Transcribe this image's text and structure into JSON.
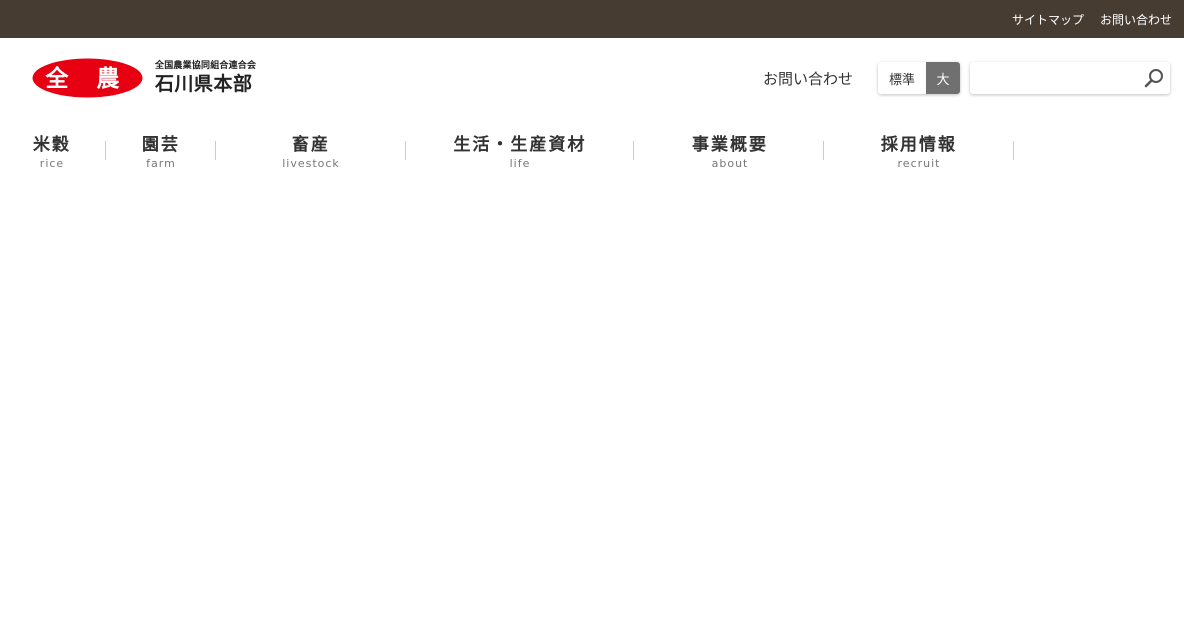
{
  "topbar": {
    "links": [
      "サイトマップ",
      "お問い合わせ"
    ]
  },
  "logo": {
    "mark_text": "全 農",
    "org_name": "全国農業協同組合連合会",
    "branch_name": "石川県本部",
    "mark_color": "#e60012"
  },
  "header": {
    "contact_label": "お問い合わせ",
    "font_size": {
      "standard_label": "標準",
      "large_label": "大"
    },
    "search": {
      "placeholder": "",
      "value": ""
    }
  },
  "gnav": {
    "items": [
      {
        "jp": "米穀",
        "en": "rice"
      },
      {
        "jp": "園芸",
        "en": "farm"
      },
      {
        "jp": "畜産",
        "en": "livestock"
      },
      {
        "jp": "生活・生産資材",
        "en": "life"
      },
      {
        "jp": "事業概要",
        "en": "about"
      },
      {
        "jp": "採用情報",
        "en": "recruit"
      }
    ]
  },
  "colors": {
    "topbar_bg": "#463c32",
    "accent_red": "#e60012",
    "toggle_active": "#707070"
  }
}
